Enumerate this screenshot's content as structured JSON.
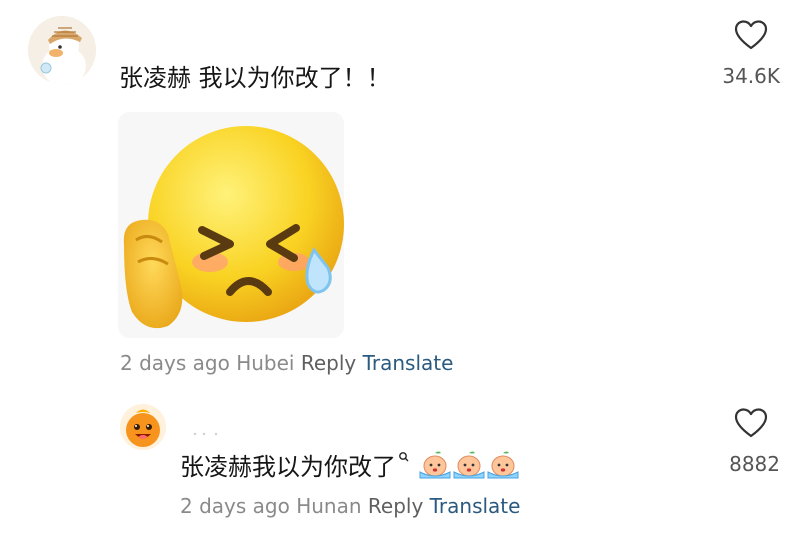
{
  "comments": [
    {
      "text": "张凌赫 我以为你改了！！",
      "time": "2 days ago",
      "location": "Hubei",
      "reply_label": "Reply",
      "translate_label": "Translate",
      "likes": "34.6K",
      "avatar_icon": "duck-with-hat-avatar",
      "sticker_icon": "crying-laughing-emoji-sticker"
    },
    {
      "text": "张凌赫我以为你改了",
      "time": "2 days ago",
      "location": "Hunan",
      "reply_label": "Reply",
      "translate_label": "Translate",
      "likes": "8882",
      "avatar_icon": "orange-cartoon-avatar",
      "inline_emojis": [
        "crying-peach-emoji",
        "crying-peach-emoji",
        "crying-peach-emoji"
      ]
    }
  ],
  "colors": {
    "translate": "#2a5a80",
    "meta": "#8a8a8a",
    "reply": "#5f5f5f"
  }
}
